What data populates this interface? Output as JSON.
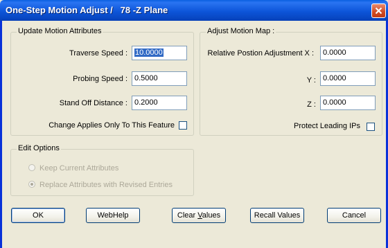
{
  "window": {
    "title": "One-Step Motion Adjust /   78 -Z Plane"
  },
  "update_motion": {
    "group_title": "Update Motion Attributes",
    "traverse_speed_label": "Traverse Speed :",
    "traverse_speed_value": "10.0000",
    "probing_speed_label": "Probing Speed :",
    "probing_speed_value": "0.5000",
    "stand_off_label": "Stand Off Distance :",
    "stand_off_value": "0.2000",
    "applies_only_label": "Change Applies Only To This Feature",
    "applies_only_checked": false
  },
  "adjust_motion": {
    "group_title": "Adjust Motion Map :",
    "x_label": "Relative Postion Adjustment X :",
    "x_value": "0.0000",
    "y_label": "Y :",
    "y_value": "0.0000",
    "z_label": "Z :",
    "z_value": "0.0000",
    "protect_label": "Protect Leading IPs",
    "protect_checked": false
  },
  "edit_options": {
    "group_title": "Edit Options",
    "keep_label": "Keep Current Attributes",
    "replace_label": "Replace Attributes with Revised Entries",
    "selected": "replace"
  },
  "buttons": {
    "ok": "OK",
    "webhelp": "WebHelp",
    "clear_prefix": "Clear ",
    "clear_underlined": "V",
    "clear_suffix": "alues",
    "recall": "Recall Values",
    "cancel": "Cancel"
  }
}
